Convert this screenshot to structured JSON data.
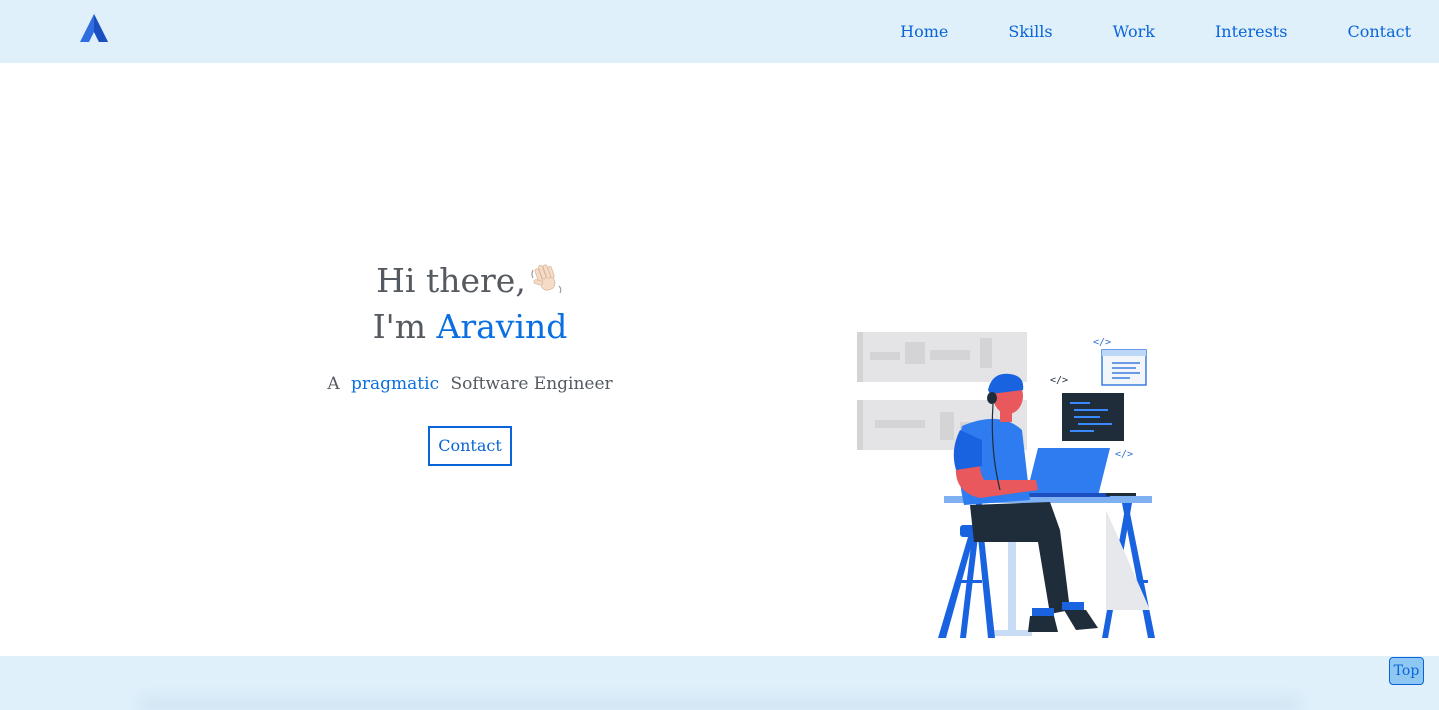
{
  "nav": {
    "logo_icon": "arch-a-logo-icon",
    "links": [
      "Home",
      "Skills",
      "Work",
      "Interests",
      "Contact"
    ]
  },
  "hero": {
    "greeting": "Hi there,",
    "wave_icon": "waving-hand-icon",
    "im_prefix": "I'm",
    "name": "Aravind",
    "tagline_prefix": "A",
    "tagline_accent": "pragmatic",
    "tagline_suffix": "Software Engineer",
    "contact_label": "Contact"
  },
  "illustration": {
    "icon": "developer-at-laptop-illustration",
    "code_tag": "</>"
  },
  "footer": {
    "top_label": "Top"
  },
  "colors": {
    "accent": "#0a64d9",
    "nav_bg": "#dff0fb",
    "text": "#555a60"
  }
}
